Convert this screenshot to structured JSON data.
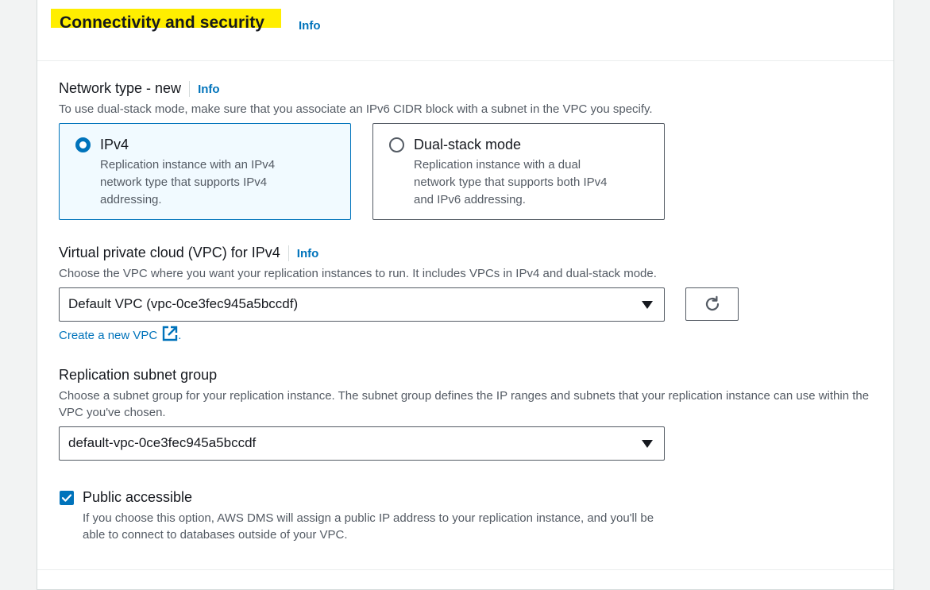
{
  "section": {
    "title": "Connectivity and security",
    "info": "Info"
  },
  "network_type": {
    "label": "Network type - new",
    "info": "Info",
    "description": "To use dual-stack mode, make sure that you associate an IPv6 CIDR block with a subnet in the VPC you specify.",
    "options": [
      {
        "title": "IPv4",
        "description": "Replication instance with an IPv4 network type that supports IPv4 addressing.",
        "selected": true
      },
      {
        "title": "Dual-stack mode",
        "description": "Replication instance with a dual network type that supports both IPv4 and IPv6 addressing.",
        "selected": false
      }
    ]
  },
  "vpc": {
    "label": "Virtual private cloud (VPC) for IPv4",
    "info": "Info",
    "description": "Choose the VPC where you want your replication instances to run. It includes VPCs in IPv4 and dual-stack mode.",
    "value": "Default VPC (vpc-0ce3fec945a5bccdf)",
    "create_link": "Create a new VPC",
    "create_link_suffix": "."
  },
  "subnet_group": {
    "label": "Replication subnet group",
    "description": "Choose a subnet group for your replication instance. The subnet group defines the IP ranges and subnets that your replication instance can use within the VPC you've chosen.",
    "value": "default-vpc-0ce3fec945a5bccdf"
  },
  "public_accessible": {
    "label": "Public accessible",
    "checked": true,
    "description": "If you choose this option, AWS DMS will assign a public IP address to your replication instance, and you'll be able to connect to databases outside of your VPC."
  },
  "colors": {
    "accent": "#0073bb",
    "highlight": "#ffee00",
    "text": "#16191f",
    "secondary_text": "#545b64"
  }
}
